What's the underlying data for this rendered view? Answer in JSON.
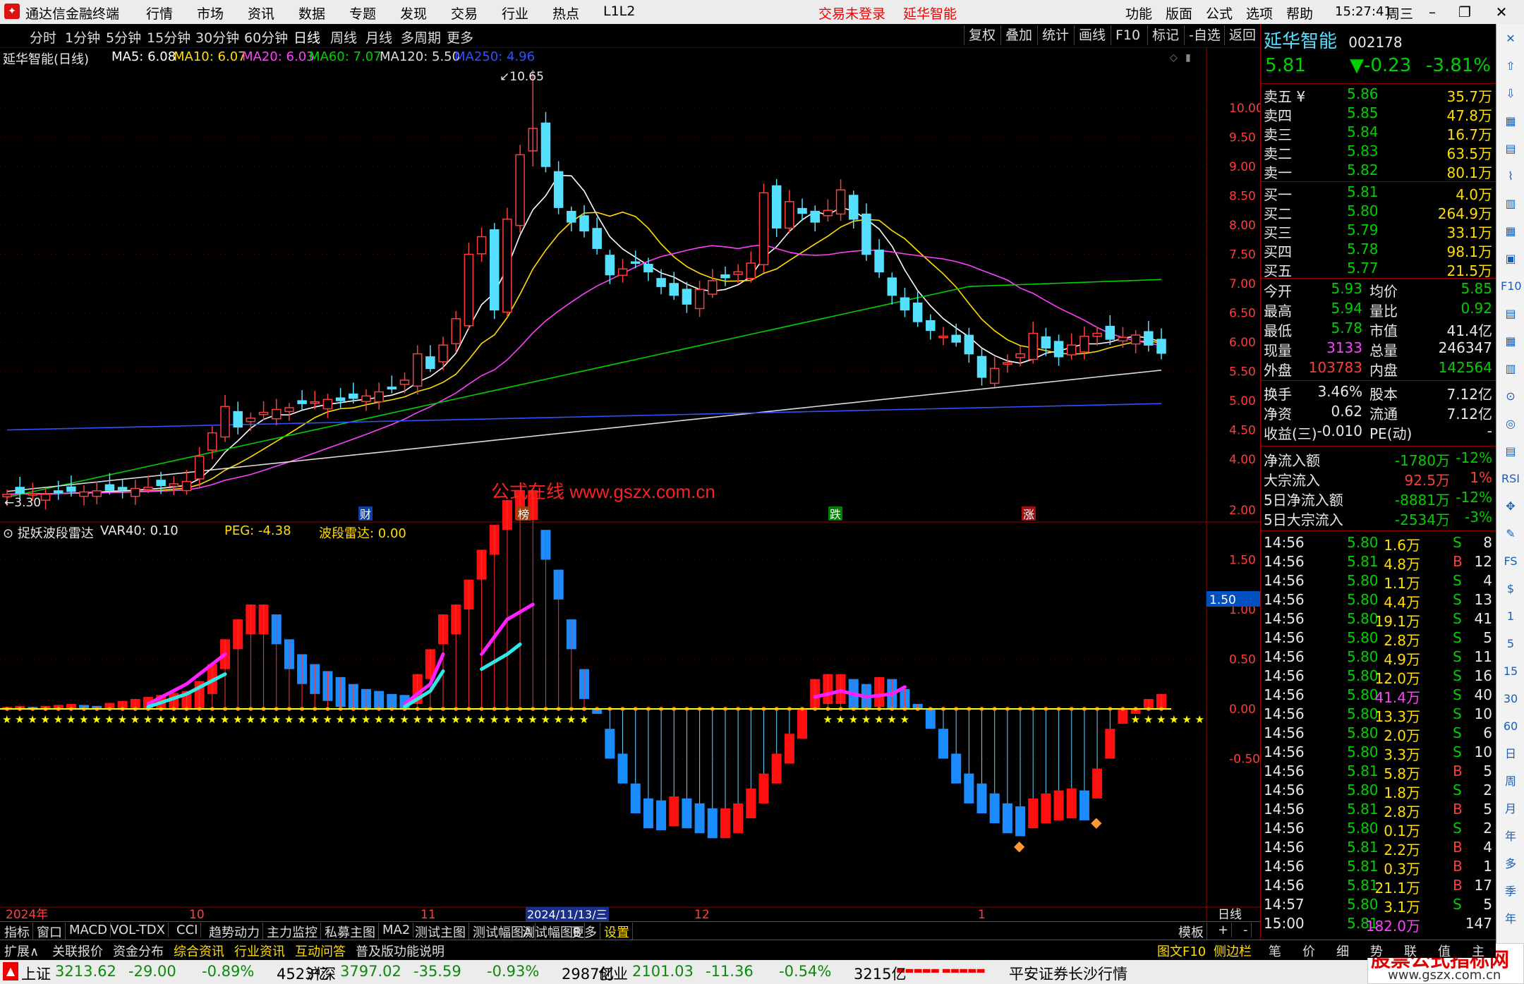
{
  "titlebar": {
    "app_name": "通达信金融终端",
    "menus": [
      "行情",
      "市场",
      "资讯",
      "数据",
      "专题",
      "发现",
      "交易",
      "行业",
      "热点",
      "L1L2"
    ],
    "trade_status": "交易未登录",
    "stock_name_title": "延华智能",
    "right_menus": [
      "功能",
      "版面",
      "公式",
      "选项",
      "帮助"
    ],
    "time": "15:27:41",
    "weekday": "周三"
  },
  "toolbar": {
    "periods": [
      "分时",
      "1分钟",
      "5分钟",
      "15分钟",
      "30分钟",
      "60分钟",
      "日线",
      "周线",
      "月线",
      "多周期",
      "更多"
    ],
    "active_period": "日线",
    "right_buttons": [
      "复权",
      "叠加",
      "统计",
      "画线",
      "F10",
      "标记",
      "-自选",
      "返回"
    ]
  },
  "main_chart": {
    "title": "延华智能(日线)",
    "ma": [
      {
        "label": "MA5: 6.08",
        "color": "#ffffff"
      },
      {
        "label": "MA10: 6.07",
        "color": "#ffde00"
      },
      {
        "label": "MA20: 6.03",
        "color": "#ff40ff"
      },
      {
        "label": "MA60: 7.07",
        "color": "#00d000"
      },
      {
        "label": "MA120: 5.50",
        "color": "#dcdcdc"
      },
      {
        "label": "MA250: 4.96",
        "color": "#3050ff"
      }
    ],
    "high_mark": "10.65",
    "low_mark": "3.30",
    "y_ticks": [
      "10.00",
      "9.50",
      "9.00",
      "8.50",
      "8.00",
      "7.50",
      "7.00",
      "6.50",
      "6.00",
      "5.50",
      "5.00",
      "4.50",
      "4.00"
    ],
    "watermark": "公式在线  www.gszx.com.cn",
    "event_tags": [
      "财",
      "榜",
      "跌",
      "涨"
    ]
  },
  "indicator": {
    "name": "捉妖波段雷达",
    "var40": "VAR40: 0.10",
    "peg": "PEG: -4.38",
    "radar": "波段雷达: 0.00",
    "y_ticks": [
      "2.00",
      "1.50",
      "1.00",
      "0.50",
      "0.00",
      "-0.50"
    ],
    "cursor_value": "1.50"
  },
  "x_axis": {
    "labels": [
      "2024年",
      "10",
      "11",
      "2024/11/13/三",
      "12",
      "1"
    ],
    "period": "日线"
  },
  "tabs1": [
    "指标",
    "窗口",
    "MACD",
    "VOL-TDX",
    "CCI",
    "趋势动力",
    "主力监控",
    "私募主图",
    "MA2",
    "测试主图",
    "测试幅图A",
    "测试幅图B",
    "更多",
    "设置"
  ],
  "tabs1_right": [
    "模板",
    "+",
    "-"
  ],
  "tabs2": [
    "扩展∧",
    "关联报价",
    "资金分布",
    "综合资讯",
    "行业资讯",
    "互动问答",
    "普及版功能说明"
  ],
  "tabs2_right": [
    "图文F10",
    "侧边栏《",
    "笔",
    "价",
    "细",
    "势",
    "联",
    "值",
    "主"
  ],
  "quote": {
    "name": "延华智能",
    "code": "002178",
    "price": "5.81",
    "change": "▼-0.23",
    "change_pct": "-3.81%",
    "asks": [
      {
        "label": "卖五 ¥",
        "price": "5.86",
        "vol": "35.7万"
      },
      {
        "label": "卖四",
        "price": "5.85",
        "vol": "47.8万"
      },
      {
        "label": "卖三",
        "price": "5.84",
        "vol": "16.7万"
      },
      {
        "label": "卖二",
        "price": "5.83",
        "vol": "63.5万"
      },
      {
        "label": "卖一",
        "price": "5.82",
        "vol": "80.1万"
      }
    ],
    "bids": [
      {
        "label": "买一",
        "price": "5.81",
        "vol": "4.0万"
      },
      {
        "label": "买二",
        "price": "5.80",
        "vol": "264.9万"
      },
      {
        "label": "买三",
        "price": "5.79",
        "vol": "33.1万"
      },
      {
        "label": "买四",
        "price": "5.78",
        "vol": "98.1万"
      },
      {
        "label": "买五",
        "price": "5.77",
        "vol": "21.5万"
      }
    ],
    "stats": [
      {
        "l1": "今开",
        "v1": "5.93",
        "l2": "均价",
        "v2": "5.85"
      },
      {
        "l1": "最高",
        "v1": "5.94",
        "l2": "量比",
        "v2": "0.92"
      },
      {
        "l1": "最低",
        "v1": "5.78",
        "l2": "市值",
        "v2": "41.4亿"
      },
      {
        "l1": "现量",
        "v1": "3133",
        "l2": "总量",
        "v2": "246347"
      },
      {
        "l1": "外盘",
        "v1": "103783",
        "l2": "内盘",
        "v2": "142564"
      }
    ],
    "stats2": [
      {
        "l1": "换手",
        "v1": "3.46%",
        "l2": "股本",
        "v2": "7.12亿"
      },
      {
        "l1": "净资",
        "v1": "0.62",
        "l2": "流通",
        "v2": "7.12亿"
      },
      {
        "l1": "收益(三)",
        "v1": "-0.010",
        "l2": "PE(动)",
        "v2": "-"
      }
    ],
    "flows": [
      {
        "label": "净流入额",
        "value": "-1780万",
        "pct": "-12%"
      },
      {
        "label": "大宗流入",
        "value": "92.5万",
        "pct": "1%"
      },
      {
        "label": "5日净流入额",
        "value": "-8881万",
        "pct": "-12%"
      },
      {
        "label": "5日大宗流入",
        "value": "-2534万",
        "pct": "-3%"
      }
    ],
    "ticks": [
      {
        "t": "14:56",
        "p": "5.80",
        "v": "1.6万",
        "s": "S",
        "n": "8"
      },
      {
        "t": "14:56",
        "p": "5.81",
        "v": "4.8万",
        "s": "B",
        "n": "12"
      },
      {
        "t": "14:56",
        "p": "5.80",
        "v": "1.1万",
        "s": "S",
        "n": "4"
      },
      {
        "t": "14:56",
        "p": "5.80",
        "v": "4.4万",
        "s": "S",
        "n": "13"
      },
      {
        "t": "14:56",
        "p": "5.80",
        "v": "19.1万",
        "s": "S",
        "n": "41"
      },
      {
        "t": "14:56",
        "p": "5.80",
        "v": "2.8万",
        "s": "S",
        "n": "5"
      },
      {
        "t": "14:56",
        "p": "5.80",
        "v": "4.9万",
        "s": "S",
        "n": "11"
      },
      {
        "t": "14:56",
        "p": "5.80",
        "v": "12.0万",
        "s": "S",
        "n": "16"
      },
      {
        "t": "14:56",
        "p": "5.80",
        "v": "41.4万",
        "s": "S",
        "n": "40"
      },
      {
        "t": "14:56",
        "p": "5.80",
        "v": "13.3万",
        "s": "S",
        "n": "10"
      },
      {
        "t": "14:56",
        "p": "5.80",
        "v": "2.0万",
        "s": "S",
        "n": "6"
      },
      {
        "t": "14:56",
        "p": "5.80",
        "v": "3.3万",
        "s": "S",
        "n": "10"
      },
      {
        "t": "14:56",
        "p": "5.81",
        "v": "5.8万",
        "s": "B",
        "n": "5"
      },
      {
        "t": "14:56",
        "p": "5.80",
        "v": "1.8万",
        "s": "S",
        "n": "2"
      },
      {
        "t": "14:56",
        "p": "5.81",
        "v": "2.8万",
        "s": "B",
        "n": "5"
      },
      {
        "t": "14:56",
        "p": "5.80",
        "v": "0.1万",
        "s": "S",
        "n": "2"
      },
      {
        "t": "14:56",
        "p": "5.81",
        "v": "2.2万",
        "s": "B",
        "n": "4"
      },
      {
        "t": "14:56",
        "p": "5.81",
        "v": "0.3万",
        "s": "B",
        "n": "1"
      },
      {
        "t": "14:56",
        "p": "5.81",
        "v": "21.1万",
        "s": "B",
        "n": "17"
      },
      {
        "t": "14:57",
        "p": "5.80",
        "v": "3.1万",
        "s": "S",
        "n": "5"
      },
      {
        "t": "15:00",
        "p": "5.81",
        "v": "182.0万",
        "s": "",
        "n": "147"
      }
    ]
  },
  "iconstrip": [
    "✕",
    "⇧",
    "⇩",
    "▦",
    "▤",
    "⌇",
    "▥",
    "▦",
    "▣",
    "F10",
    "▤",
    "▦",
    "▥",
    "⊙",
    "◎",
    "▤",
    "RSI",
    "✥",
    "✎",
    "FS",
    "$",
    "1",
    "5",
    "15",
    "30",
    "60",
    "日",
    "周",
    "月",
    "年",
    "多",
    "季",
    "年"
  ],
  "statusbar": {
    "indices": [
      {
        "name": "上证",
        "value": "3213.62",
        "chg": "-29.00",
        "pct": "-0.89%",
        "amt": "4523亿"
      },
      {
        "name": "沪深",
        "value": "3797.02",
        "chg": "-35.59",
        "pct": "-0.93%",
        "amt": "2987亿"
      },
      {
        "name": "创业",
        "value": "2101.03",
        "chg": "-11.36",
        "pct": "-0.54%",
        "amt": "3215亿"
      }
    ],
    "broker": "平安证券长沙行情",
    "brand": "股票公式指标网",
    "brand_url": "www.gszx.com.cn"
  }
}
